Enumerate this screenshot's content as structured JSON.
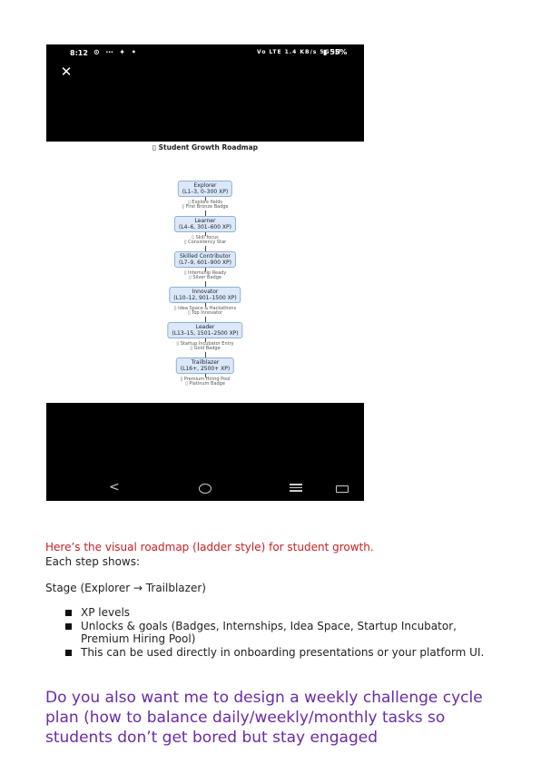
{
  "phone": {
    "status": {
      "time": "8:12",
      "left_icons": "⊙ ⋯ ✦ •",
      "network": "Vo LTE 1.4 KB/s 5G ıll",
      "battery": "▮ 55%"
    },
    "close_glyph": "✕",
    "roadmap": {
      "title": "▯ Student Growth Roadmap",
      "stages": [
        {
          "name": "Explorer",
          "range": "(L1–3, 0–300 XP)",
          "unlocks": [
            "▯ Explore fields",
            "▯ First Bronze Badge"
          ]
        },
        {
          "name": "Learner",
          "range": "(L4–6, 301–600 XP)",
          "unlocks": [
            "▯ Skill focus",
            "▯ Consistency Star"
          ]
        },
        {
          "name": "Skilled Contributor",
          "range": "(L7–9, 601–900 XP)",
          "unlocks": [
            "▯ Internship Ready",
            "▯ Silver Badge"
          ]
        },
        {
          "name": "Innovator",
          "range": "(L10–12, 901–1500 XP)",
          "unlocks": [
            "▯ Idea Space & Hackathons",
            "▯ Top Innovator"
          ]
        },
        {
          "name": "Leader",
          "range": "(L13–15, 1501–2500 XP)",
          "unlocks": [
            "▯ Startup Incubator Entry",
            "▯ Gold Badge"
          ]
        },
        {
          "name": "Trailblazer",
          "range": "(L16+, 2500+ XP)",
          "unlocks": [
            "▯ Premium Hiring Pool",
            "▯ Platinum Badge"
          ]
        }
      ]
    },
    "nav": {
      "back": "<"
    }
  },
  "text": {
    "intro": "Here’s the visual roadmap (ladder style) for student growth.",
    "each_step": "Each step shows:",
    "stage_line": "Stage (Explorer → Trailblazer)",
    "bullets": [
      "XP levels",
      "Unlocks & goals (Badges, Internships, Idea Space, Startup Incubator, Premium Hiring Pool)",
      "This can be used directly in onboarding presentations or your platform UI."
    ],
    "question": "Do you also want me to design a weekly challenge cycle plan (how to balance daily/weekly/monthly tasks so students don’t get bored but stay engaged"
  }
}
